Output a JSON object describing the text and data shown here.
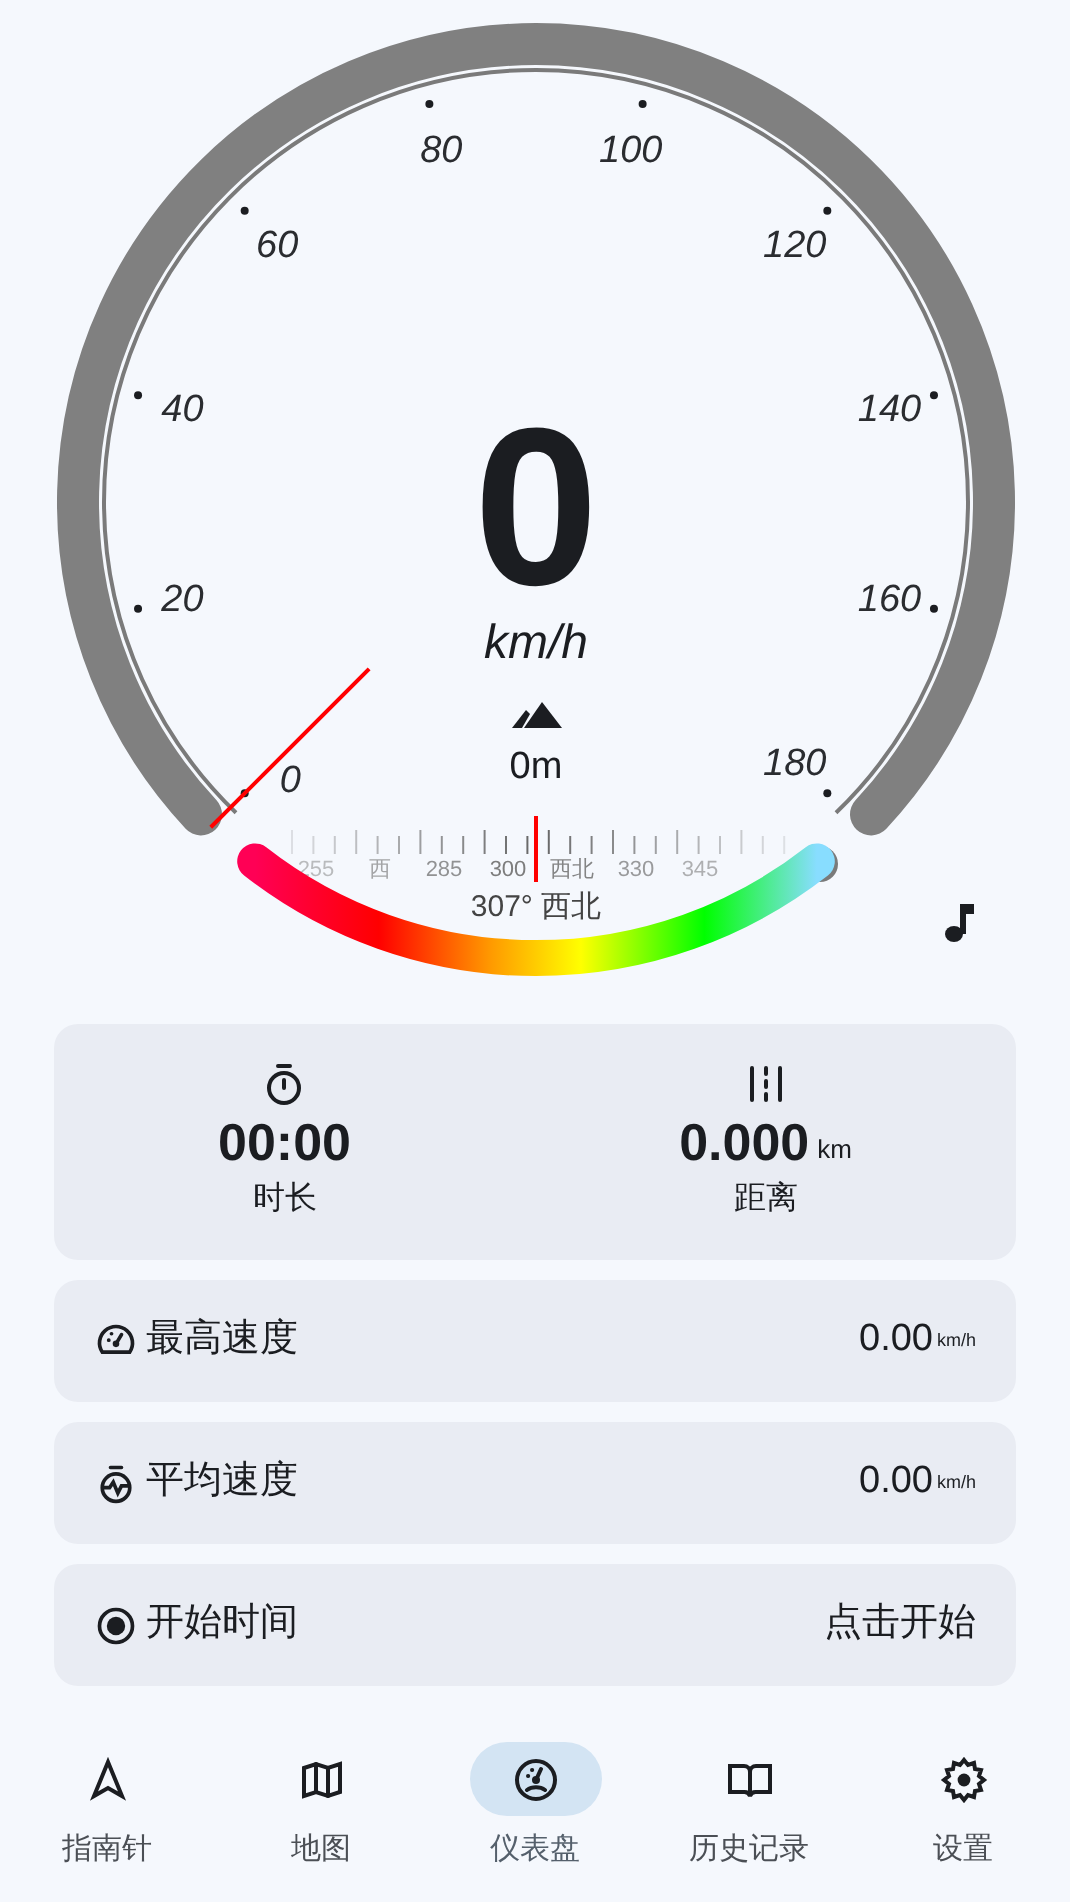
{
  "gauge": {
    "scale_labels": [
      "0",
      "20",
      "40",
      "60",
      "80",
      "100",
      "120",
      "140",
      "160",
      "180"
    ],
    "speed": "0",
    "unit": "km/h",
    "altitude": "0m"
  },
  "compass": {
    "scale_labels": [
      "255",
      "西",
      "285",
      "300",
      "西北",
      "330",
      "345"
    ],
    "reading": "307° 西北"
  },
  "summary": [
    {
      "kind": "timer",
      "value": "00:00",
      "label": "时长"
    },
    {
      "kind": "distance",
      "value": "0.000",
      "unit": "km",
      "label": "距离"
    }
  ],
  "stats": [
    {
      "kind": "max",
      "label": "最高速度",
      "value": "0.00",
      "unit": "km/h"
    },
    {
      "kind": "average",
      "label": "平均速度",
      "value": "0.00",
      "unit": "km/h"
    },
    {
      "kind": "start",
      "label": "开始时间",
      "value": "点击开始"
    }
  ],
  "nav": [
    {
      "kind": "compass",
      "label": "指南针",
      "selected": false
    },
    {
      "kind": "map",
      "label": "地图",
      "selected": false
    },
    {
      "kind": "dashboard",
      "label": "仪表盘",
      "selected": true
    },
    {
      "kind": "history",
      "label": "历史记录",
      "selected": false
    },
    {
      "kind": "settings",
      "label": "设置",
      "selected": false
    }
  ]
}
